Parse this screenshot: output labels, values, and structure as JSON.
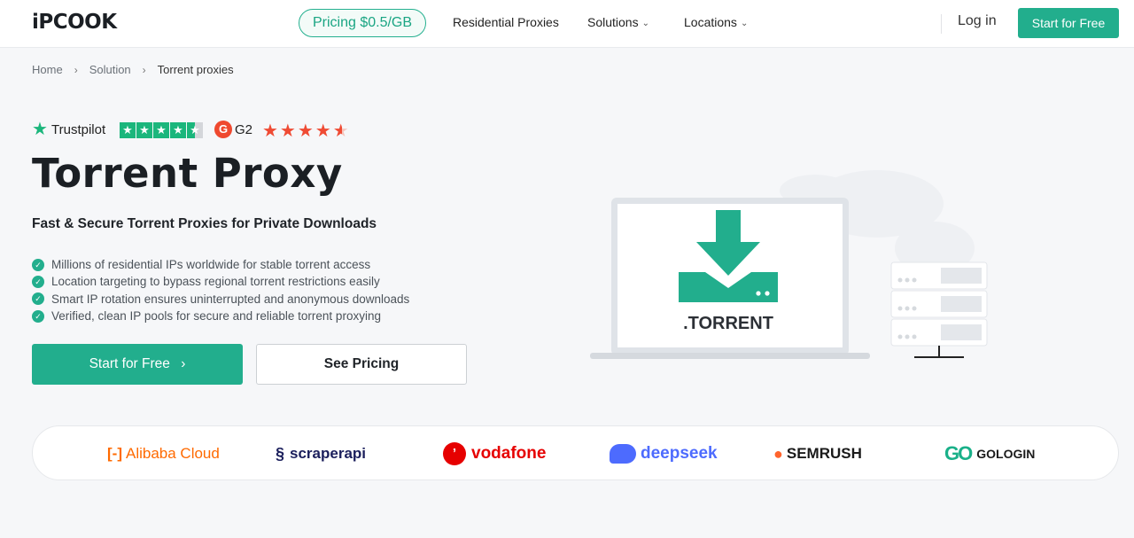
{
  "header": {
    "logo": "iPCOOK",
    "pricing_pill": "Pricing $0.5/GB",
    "nav": [
      "Residential Proxies",
      "Solutions",
      "Locations"
    ],
    "login": "Log in",
    "start_button": "Start for Free"
  },
  "breadcrumb": [
    "Home",
    "Solution",
    "Torrent proxies"
  ],
  "ratings": {
    "trustpilot_label": "Trustpilot",
    "trustpilot_stars": 4.5,
    "g2_label": "G2",
    "g2_stars": 4.5
  },
  "hero": {
    "title": "Torrent Proxy",
    "subtitle": "Fast & Secure Torrent Proxies for Private Downloads",
    "features": [
      "Millions of residential IPs worldwide for stable torrent access",
      "Location targeting to bypass regional torrent restrictions easily",
      "Smart IP rotation ensures uninterrupted and anonymous downloads",
      "Verified, clean IP pools for secure and reliable torrent proxying"
    ],
    "primary_cta": "Start for Free",
    "secondary_cta": "See Pricing"
  },
  "illustration": {
    "screen_label": ".TORRENT"
  },
  "partners": [
    {
      "name": "Alibaba Cloud",
      "icon": "alibaba-icon",
      "color": "#ff6a00"
    },
    {
      "name": "scraperapi",
      "icon": "scraperapi-icon",
      "color": "#1b1f5c"
    },
    {
      "name": "vodafone",
      "icon": "vodafone-icon",
      "color": "#e60000"
    },
    {
      "name": "deepseek",
      "icon": "deepseek-icon",
      "color": "#4d6bfe"
    },
    {
      "name": "SEMRUSH",
      "icon": "semrush-icon",
      "color": "#ff642d"
    },
    {
      "name": "GOLOGIN",
      "icon": "gologin-icon",
      "color": "#1ab089"
    }
  ],
  "colors": {
    "accent": "#22ae8d",
    "g2": "#ef492f",
    "trustpilot": "#1bb67c"
  }
}
